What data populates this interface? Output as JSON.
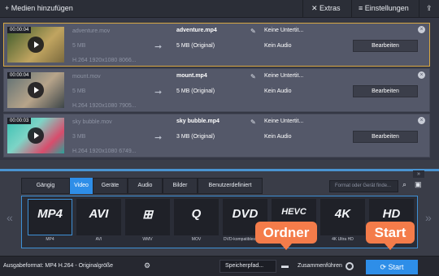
{
  "toolbar": {
    "add_media": "+ Medien hinzufügen",
    "extras": "✕ Extras",
    "settings": "≡ Einstellungen",
    "share_icon": "share-icon"
  },
  "files": [
    {
      "duration": "00:00:04",
      "source_name": "adventure.mov",
      "source_size": "5 MB",
      "source_meta": "H.264 1920x1080 8066...",
      "output_name": "adventure.mp4",
      "output_size": "5 MB (Original)",
      "subtitles": "Keine Untertit...",
      "audio": "Kein Audio",
      "edit_label": "Bearbeiten",
      "thumb_colors": [
        "#4f6e34",
        "#c0a460"
      ]
    },
    {
      "duration": "00:00:04",
      "source_name": "mount.mov",
      "source_size": "5 MB",
      "source_meta": "H.264 1920x1080 7905...",
      "output_name": "mount.mp4",
      "output_size": "5 MB (Original)",
      "subtitles": "Keine Untertit...",
      "audio": "Kein Audio",
      "edit_label": "Bearbeiten",
      "thumb_colors": [
        "#6b7c80",
        "#b7a48a"
      ]
    },
    {
      "duration": "00:00:03",
      "source_name": "sky bubble.mov",
      "source_size": "3 MB",
      "source_meta": "H.264 1920x1080 6749...",
      "output_name": "sky bubble.mp4",
      "output_size": "3 MB (Original)",
      "subtitles": "Keine Untertit...",
      "audio": "Kein Audio",
      "edit_label": "Bearbeiten",
      "thumb_colors": [
        "#39c0b2",
        "#d84c6c"
      ]
    }
  ],
  "tabs": [
    "Gängig",
    "Video",
    "Geräte",
    "Audio",
    "Bilder",
    "Benutzerdefiniert"
  ],
  "active_tab": "Video",
  "search_placeholder": "Format oder Gerät finde...",
  "formats": [
    {
      "logo": "MP4",
      "label": "MP4"
    },
    {
      "logo": "AVI",
      "label": "AVI"
    },
    {
      "logo": "⊞",
      "label": "WMV"
    },
    {
      "logo": "Q",
      "label": "MOV"
    },
    {
      "logo": "DVD",
      "label": "DVD-kompatibles Video"
    },
    {
      "logo": "HEVC",
      "label": ""
    },
    {
      "logo": "4K",
      "label": "4K Ultra HD"
    },
    {
      "logo": "HD",
      "label": ""
    }
  ],
  "bottom": {
    "output_format": "Ausgabeformat: MP4 H.264 - Originalgröße",
    "save_path": "Speicherpfad...",
    "merge": "Zusammenführen",
    "start": "Start"
  },
  "callouts": {
    "folder": "Ordner",
    "start": "Start"
  },
  "accent_color": "#2e8ee8",
  "callout_color": "#f47c4a"
}
